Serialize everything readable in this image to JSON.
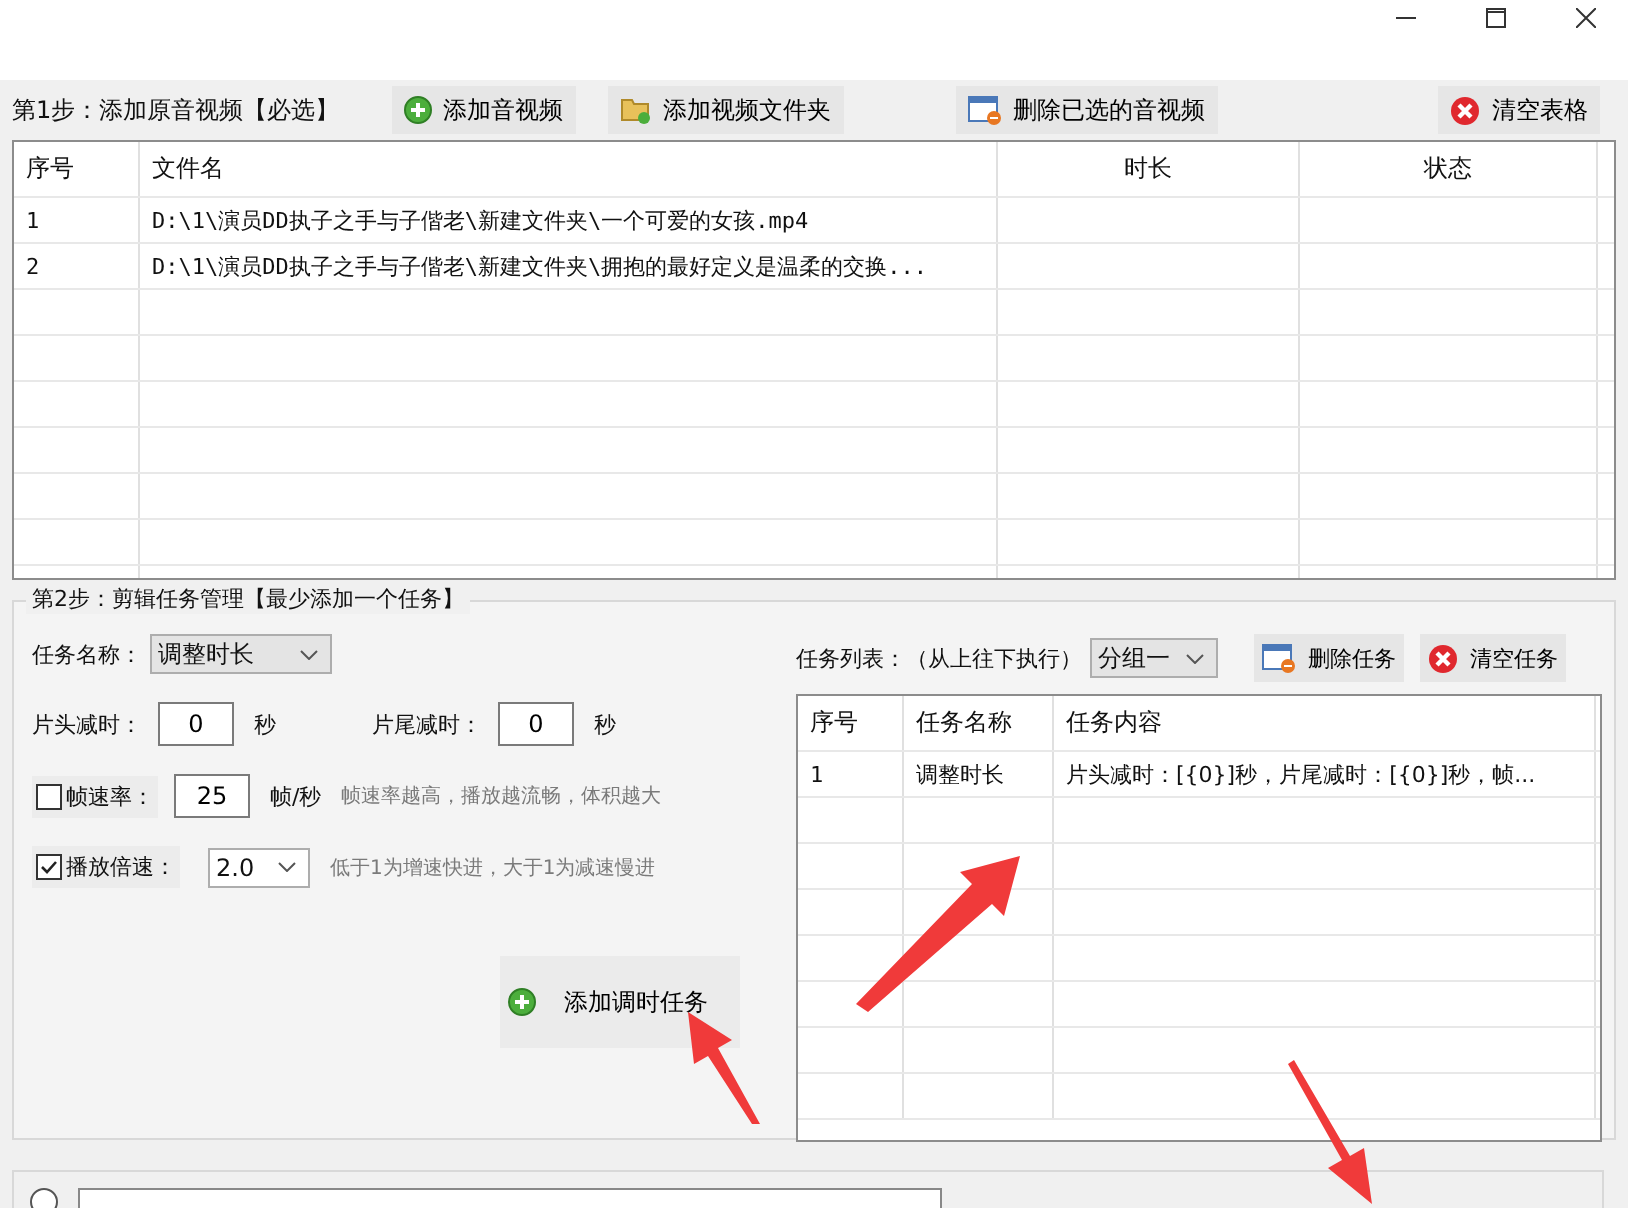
{
  "step1": {
    "label": "第1步：添加原音视频【必选】",
    "buttons": [
      {
        "kind": "add",
        "label": "添加音视频"
      },
      {
        "kind": "folder",
        "label": "添加视频文件夹"
      },
      {
        "kind": "remove",
        "label": "删除已选的音视频"
      },
      {
        "kind": "clear",
        "label": "清空表格"
      }
    ]
  },
  "files_table": {
    "columns": [
      "序号",
      "文件名",
      "时长",
      "状态"
    ],
    "rows": [
      {
        "cells": [
          "1",
          "D:\\1\\演员DD执子之手与子偕老\\新建文件夹\\一个可爱的女孩.mp4",
          "",
          ""
        ]
      },
      {
        "cells": [
          "2",
          "D:\\1\\演员DD执子之手与子偕老\\新建文件夹\\拥抱的最好定义是温柔的交换...",
          "",
          ""
        ]
      }
    ]
  },
  "step2": {
    "label": "第2步：剪辑任务管理【最少添加一个任务】",
    "task_name": {
      "label": "任务名称：",
      "value": "调整时长"
    },
    "head_cut": {
      "label": "片头减时：",
      "value": "0",
      "unit": "秒"
    },
    "tail_cut": {
      "label": "片尾减时：",
      "value": "0",
      "unit": "秒"
    },
    "frame_rate": {
      "label": "帧速率：",
      "checked": false,
      "value": "25",
      "unit": "帧/秒",
      "hint": "帧速率越高，播放越流畅，体积越大"
    },
    "speed": {
      "label": "播放倍速：",
      "checked": true,
      "value": "2.0",
      "hint": "低于1为增速快进，大于1为减速慢进"
    },
    "add_button": "添加调时任务",
    "task_list": {
      "label": "任务列表：（从上往下执行）",
      "group": "分组一",
      "buttons": [
        {
          "kind": "remove",
          "label": "删除任务"
        },
        {
          "kind": "clear",
          "label": "清空任务"
        }
      ],
      "columns": [
        "序号",
        "任务名称",
        "任务内容"
      ],
      "rows": [
        {
          "cells": [
            "1",
            "调整时长",
            "片头减时：[{0}]秒，片尾减时：[{0}]秒，帧..."
          ]
        }
      ]
    }
  },
  "output_option": {
    "selected": false
  }
}
